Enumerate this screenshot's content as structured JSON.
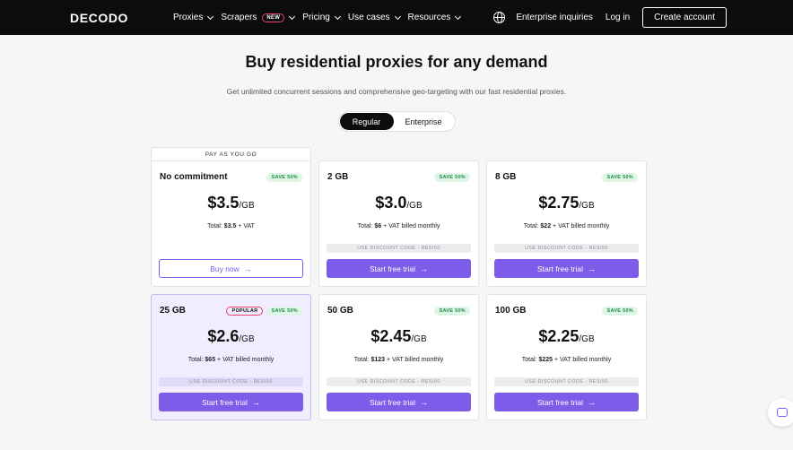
{
  "nav": {
    "logo": "DECODO",
    "items": [
      {
        "label": "Proxies"
      },
      {
        "label": "Scrapers",
        "badge": "NEW"
      },
      {
        "label": "Pricing"
      },
      {
        "label": "Use cases"
      },
      {
        "label": "Resources"
      }
    ],
    "globe_icon": "globe-icon",
    "enterprise_link": "Enterprise inquiries",
    "login": "Log in",
    "create_account": "Create account"
  },
  "hero": {
    "title": "Buy residential proxies for any demand",
    "subtitle": "Get unlimited concurrent sessions and comprehensive geo-targeting with our fast residential proxies."
  },
  "toggle": {
    "regular": "Regular",
    "enterprise": "Enterprise",
    "selected": "Regular"
  },
  "plans": [
    {
      "section_label": "PAY AS YOU GO",
      "name": "No commitment",
      "save": "SAVE 50%",
      "price": "$3.5",
      "unit": "/GB",
      "total_prefix": "Total: ",
      "total_amount": "$3.5",
      "total_suffix": " + VAT",
      "button": "Buy now",
      "button_style": "outline"
    },
    {
      "name": "2 GB",
      "save": "SAVE 50%",
      "price": "$3.0",
      "unit": "/GB",
      "total_prefix": "Total: ",
      "total_amount": "$6",
      "total_suffix": " + VAT billed monthly",
      "discount": "USE DISCOUNT CODE - RESI50",
      "button": "Start free trial",
      "button_style": "primary"
    },
    {
      "name": "8 GB",
      "save": "SAVE 50%",
      "price": "$2.75",
      "unit": "/GB",
      "total_prefix": "Total: ",
      "total_amount": "$22",
      "total_suffix": " + VAT billed monthly",
      "discount": "USE DISCOUNT CODE - RESI50",
      "button": "Start free trial",
      "button_style": "primary"
    },
    {
      "name": "25 GB",
      "popular": "POPULAR",
      "save": "SAVE 50%",
      "price": "$2.6",
      "unit": "/GB",
      "total_prefix": "Total: ",
      "total_amount": "$65",
      "total_suffix": " + VAT billed monthly",
      "discount": "USE DISCOUNT CODE - RESI50",
      "button": "Start free trial",
      "button_style": "primary"
    },
    {
      "name": "50 GB",
      "save": "SAVE 50%",
      "price": "$2.45",
      "unit": "/GB",
      "total_prefix": "Total: ",
      "total_amount": "$123",
      "total_suffix": " + VAT billed monthly",
      "discount": "USE DISCOUNT CODE - RESI50",
      "button": "Start free trial",
      "button_style": "primary"
    },
    {
      "name": "100 GB",
      "save": "SAVE 50%",
      "price": "$2.25",
      "unit": "/GB",
      "total_prefix": "Total: ",
      "total_amount": "$225",
      "total_suffix": " + VAT billed monthly",
      "discount": "USE DISCOUNT CODE - RESI50",
      "button": "Start free trial",
      "button_style": "primary"
    }
  ],
  "colors": {
    "accent": "#7c5ce8",
    "nav_bg": "#0c0c0f",
    "save_green": "#1e8a45",
    "popular_pink": "#e8406b"
  },
  "chat_icon": "chat-icon"
}
